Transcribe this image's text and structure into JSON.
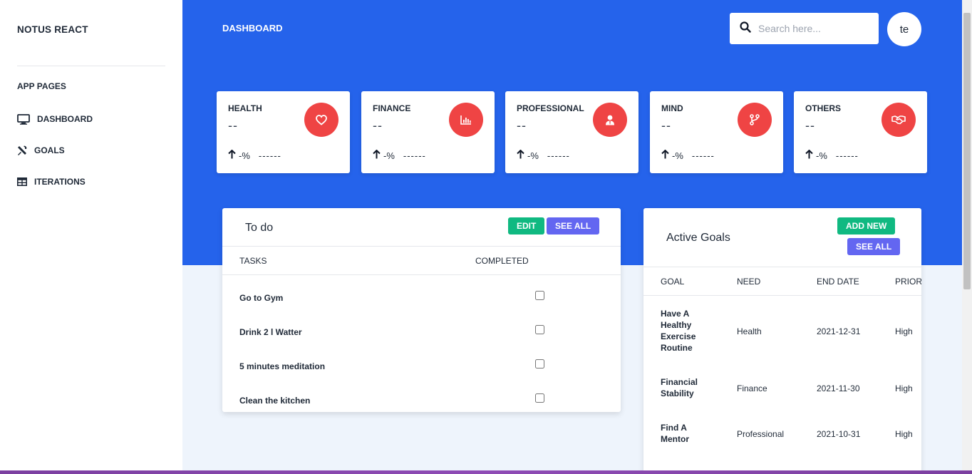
{
  "sidebar": {
    "brand": "NOTUS REACT",
    "section_label": "APP PAGES",
    "items": [
      {
        "label": "DASHBOARD",
        "icon": "desktop-icon"
      },
      {
        "label": "GOALS",
        "icon": "tools-icon"
      },
      {
        "label": "ITERATIONS",
        "icon": "table-icon"
      }
    ]
  },
  "header": {
    "title": "DASHBOARD",
    "search_placeholder": "Search here...",
    "avatar_text": "te"
  },
  "stats": [
    {
      "title": "HEALTH",
      "value": "--",
      "percent": "-%",
      "subtext": "------",
      "icon": "heart-icon"
    },
    {
      "title": "FINANCE",
      "value": "--",
      "percent": "-%",
      "subtext": "------",
      "icon": "chart-icon"
    },
    {
      "title": "PROFESSIONAL",
      "value": "--",
      "percent": "-%",
      "subtext": "------",
      "icon": "user-tie-icon"
    },
    {
      "title": "MIND",
      "value": "--",
      "percent": "-%",
      "subtext": "------",
      "icon": "branch-icon"
    },
    {
      "title": "OTHERS",
      "value": "--",
      "percent": "-%",
      "subtext": "------",
      "icon": "handshake-icon"
    }
  ],
  "todo": {
    "title": "To do",
    "edit_label": "EDIT",
    "see_all_label": "SEE ALL",
    "columns": [
      "TASKS",
      "COMPLETED"
    ],
    "rows": [
      {
        "task": "Go to Gym",
        "completed": false
      },
      {
        "task": "Drink 2 l Watter",
        "completed": false
      },
      {
        "task": "5 minutes meditation",
        "completed": false
      },
      {
        "task": "Clean the kitchen",
        "completed": false
      }
    ]
  },
  "goals": {
    "title": "Active Goals",
    "add_new_label": "ADD NEW",
    "see_all_label": "SEE ALL",
    "columns": [
      "GOAL",
      "NEED",
      "END DATE",
      "PRIORI"
    ],
    "rows": [
      {
        "goal": "Have A Healthy Exercise Routine",
        "need": "Health",
        "end_date": "2021-12-31",
        "priority": "High"
      },
      {
        "goal": "Financial Stability",
        "need": "Finance",
        "end_date": "2021-11-30",
        "priority": "High"
      },
      {
        "goal": "Find A Mentor",
        "need": "Professional",
        "end_date": "2021-10-31",
        "priority": "High"
      }
    ]
  },
  "colors": {
    "header_bg": "#2563eb",
    "stat_icon_bg": "#ef4444",
    "edit_btn": "#10b981",
    "see_all_btn": "#6366f1"
  }
}
